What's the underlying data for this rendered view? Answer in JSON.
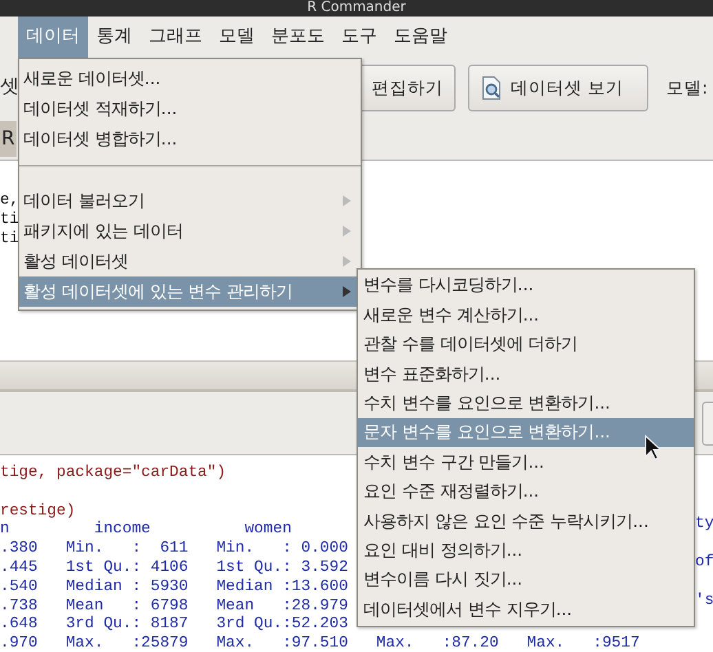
{
  "window": {
    "title": "R Commander"
  },
  "menubar": [
    {
      "label": "데이터",
      "selected": true
    },
    {
      "label": "통계",
      "selected": false
    },
    {
      "label": "그래프",
      "selected": false
    },
    {
      "label": "모델",
      "selected": false
    },
    {
      "label": "분포도",
      "selected": false
    },
    {
      "label": "도구",
      "selected": false
    },
    {
      "label": "도움말",
      "selected": false
    }
  ],
  "toolbar": {
    "partial_label": "셋",
    "buttons": [
      {
        "label": "편집하기"
      },
      {
        "label": "데이터셋 보기"
      }
    ],
    "model_label": "모델:"
  },
  "toolbar_2": {
    "button_label": "R"
  },
  "script_window": {
    "lines": [
      "e,",
      "ti",
      "ti"
    ]
  },
  "output_window": {
    "lines": [
      {
        "kind": "command",
        "text": "tige, package=\"carData\")"
      },
      {
        "kind": "blank"
      },
      {
        "kind": "command",
        "text": "restige)"
      },
      {
        "kind": "output",
        "text": "n         income          women",
        "right": "ty"
      },
      {
        "kind": "output",
        "text": ".380   Min.   :  611   Min.   : 0.000"
      },
      {
        "kind": "output",
        "text": ".445   1st Qu.: 4106   1st Qu.: 3.592",
        "right": "of"
      },
      {
        "kind": "output",
        "text": ".540   Median : 5930   Median :13.600"
      },
      {
        "kind": "output",
        "text": ".738   Mean   : 6798   Mean   :28.979",
        "right": "'s"
      },
      {
        "kind": "output",
        "text": ".648   3rd Qu.: 8187   3rd Qu.:52.203"
      },
      {
        "kind": "output",
        "text": ".970   Max.   :25879   Max.   :97.510   Max.   :87.20   Max.   :9517"
      }
    ]
  },
  "data_menu": {
    "items": [
      {
        "kind": "item",
        "label": "새로운 데이터셋...",
        "submenu": false,
        "selected": false
      },
      {
        "kind": "item",
        "label": "데이터셋 적재하기...",
        "submenu": false,
        "selected": false
      },
      {
        "kind": "item",
        "label": "데이터셋 병합하기...",
        "submenu": false,
        "selected": false
      },
      {
        "kind": "separator"
      },
      {
        "kind": "item",
        "label": "데이터 불러오기",
        "submenu": true,
        "selected": false
      },
      {
        "kind": "item",
        "label": "패키지에 있는 데이터",
        "submenu": true,
        "selected": false
      },
      {
        "kind": "item",
        "label": "활성 데이터셋",
        "submenu": true,
        "selected": false
      },
      {
        "kind": "item",
        "label": "활성 데이터셋에 있는 변수 관리하기",
        "submenu": true,
        "selected": true
      }
    ]
  },
  "submenu": {
    "items": [
      {
        "label": "변수를 다시코딩하기...",
        "selected": false
      },
      {
        "label": "새로운 변수 계산하기...",
        "selected": false
      },
      {
        "label": "관찰 수를 데이터셋에 더하기",
        "selected": false
      },
      {
        "label": "변수 표준화하기...",
        "selected": false
      },
      {
        "label": "수치 변수를 요인으로 변환하기...",
        "selected": false
      },
      {
        "label": "문자 변수를 요인으로 변환하기...",
        "selected": true
      },
      {
        "label": "수치 변수 구간 만들기...",
        "selected": false
      },
      {
        "label": "요인 수준 재정렬하기...",
        "selected": false
      },
      {
        "label": "사용하지 않은 요인 수준 누락시키기...",
        "selected": false
      },
      {
        "label": "요인 대비 정의하기...",
        "selected": false
      },
      {
        "label": "변수이름 다시 짓기...",
        "selected": false
      },
      {
        "label": "데이터셋에서 변수 지우기...",
        "selected": false
      }
    ]
  }
}
